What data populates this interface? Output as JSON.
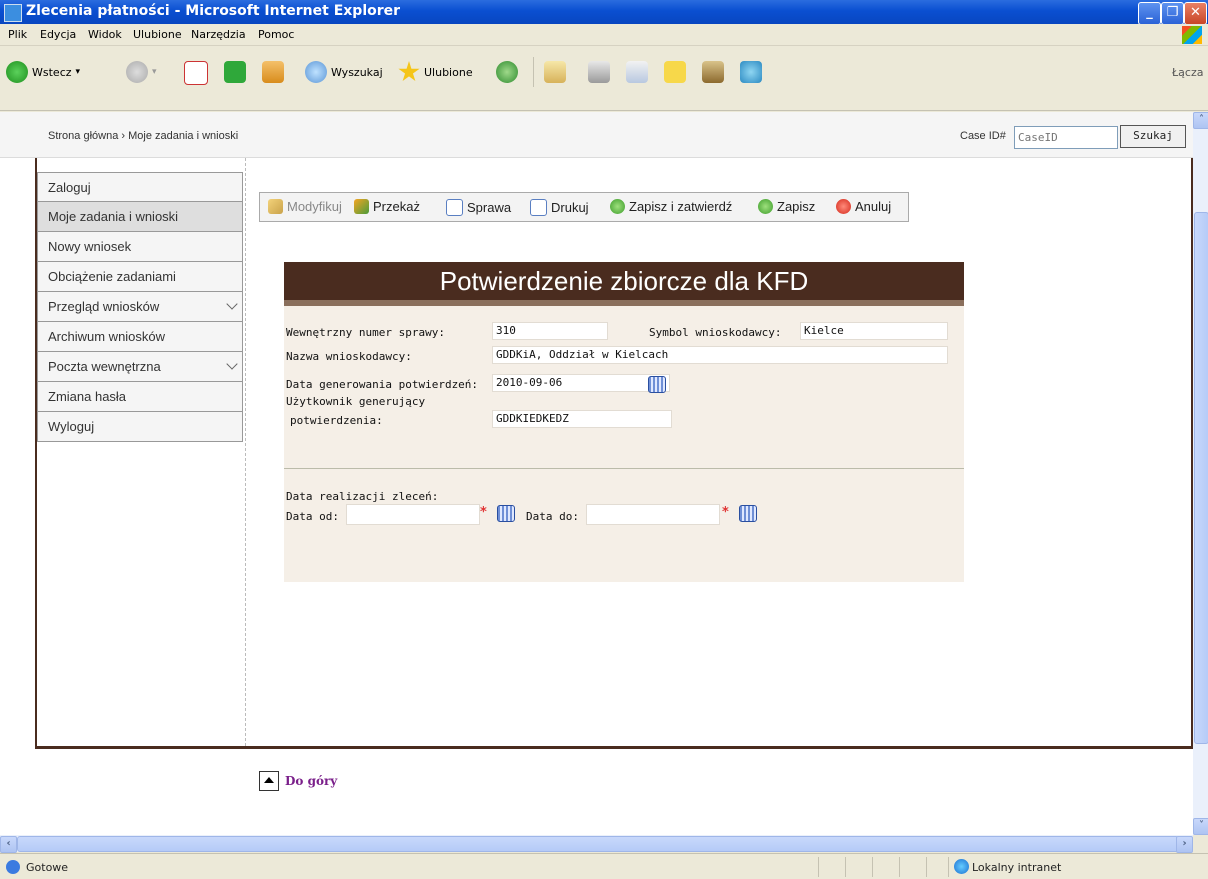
{
  "window": {
    "title": "Zlecenia płatności - Microsoft Internet Explorer"
  },
  "menu": [
    "Plik",
    "Edycja",
    "Widok",
    "Ulubione",
    "Narzędzia",
    "Pomoc"
  ],
  "toolbar": {
    "back": "Wstecz",
    "search": "Wyszukaj",
    "favorites": "Ulubione",
    "links": "Łącza"
  },
  "header": {
    "breadcrumb": "Strona główna › Moje zadania i wnioski",
    "case_label": "Case ID#",
    "case_placeholder": "CaseID",
    "search_button": "Szukaj"
  },
  "sidebar": {
    "items": [
      {
        "label": "Zaloguj"
      },
      {
        "label": "Moje zadania i wnioski"
      },
      {
        "label": "Nowy wniosek"
      },
      {
        "label": "Obciążenie zadaniami"
      },
      {
        "label": "Przegląd wniosków"
      },
      {
        "label": "Archiwum wniosków"
      },
      {
        "label": "Poczta wewnętrzna"
      },
      {
        "label": "Zmiana hasła"
      },
      {
        "label": "Wyloguj"
      }
    ]
  },
  "actions": {
    "modify": "Modyfikuj",
    "transfer": "Przekaż",
    "case": "Sprawa",
    "print": "Drukuj",
    "save_approve": "Zapisz i zatwierdź",
    "save": "Zapisz",
    "cancel": "Anuluj"
  },
  "form": {
    "title": "Potwierdzenie zbiorcze dla KFD",
    "internal_number_label": "Wewnętrzny numer sprawy:",
    "internal_number": "310",
    "applicant_symbol_label": "Symbol wnioskodawcy:",
    "applicant_symbol": "Kielce",
    "applicant_name_label": "Nazwa wnioskodawcy:",
    "applicant_name": "GDDKiA, Oddział w Kielcach",
    "gen_date_label": "Data generowania potwierdzeń:",
    "gen_date": "2010-09-06",
    "gen_user_label_1": "Użytkownik generujący",
    "gen_user_label_2": "potwierdzenia:",
    "gen_user": "GDDKIEDKEDZ",
    "realization_label": "Data realizacji zleceń:",
    "date_from_label": "Data od:",
    "date_from": "",
    "date_to_label": "Data do:",
    "date_to": "",
    "required_mark": "*"
  },
  "footer": {
    "back_to_top": "Do góry"
  },
  "status": {
    "text": "Gotowe",
    "zone": "Lokalny intranet"
  }
}
